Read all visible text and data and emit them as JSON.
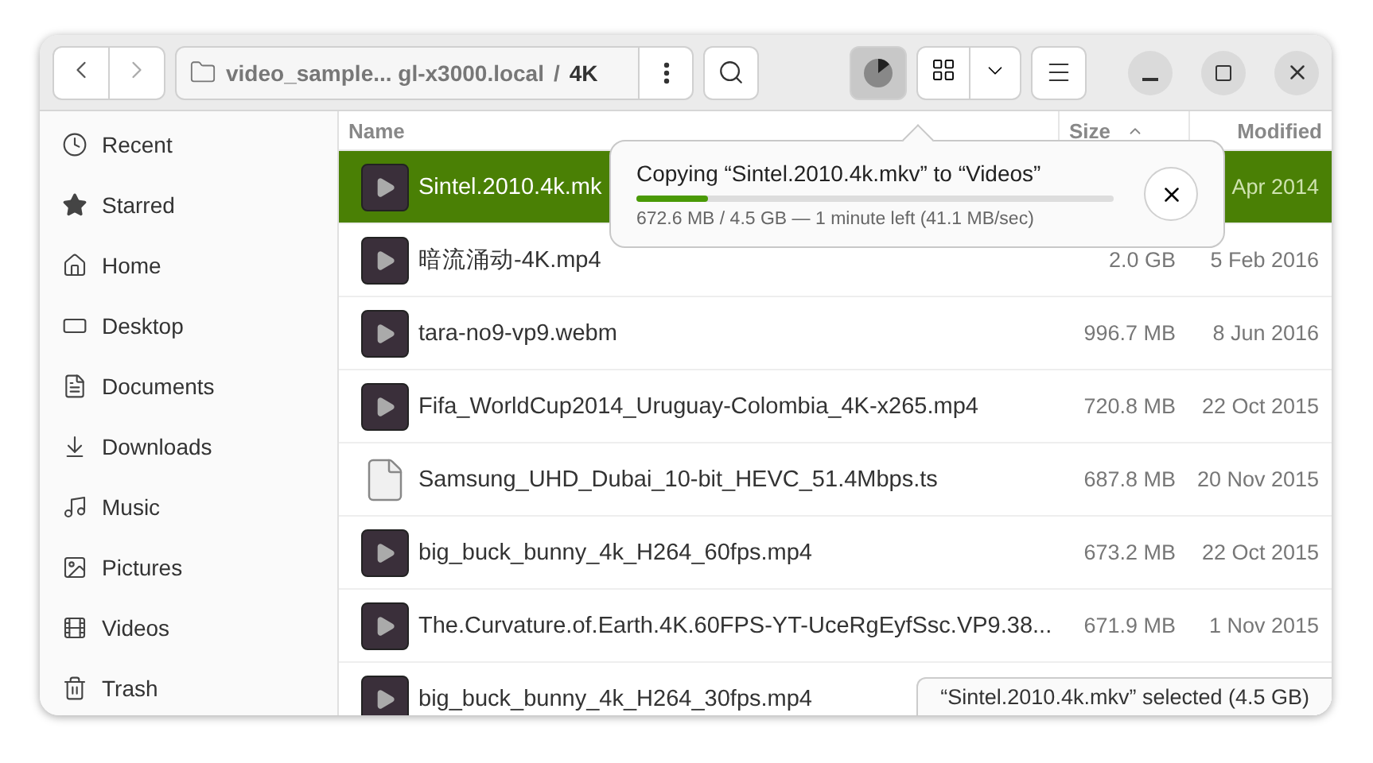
{
  "header": {
    "path_parent": "video_sample... gl-x3000.local",
    "path_separator": "/",
    "path_current": "4K"
  },
  "sidebar": {
    "items": [
      {
        "label": "Recent",
        "selected": false
      },
      {
        "label": "Starred",
        "selected": false
      },
      {
        "label": "Home",
        "selected": false
      },
      {
        "label": "Desktop",
        "selected": false
      },
      {
        "label": "Documents",
        "selected": false
      },
      {
        "label": "Downloads",
        "selected": false
      },
      {
        "label": "Music",
        "selected": false
      },
      {
        "label": "Pictures",
        "selected": false
      },
      {
        "label": "Videos",
        "selected": false
      },
      {
        "label": "Trash",
        "selected": false
      }
    ]
  },
  "table": {
    "columns": [
      "Name",
      "Size",
      "Modified"
    ],
    "rows": [
      {
        "name": "Sintel.2010.4k.mk",
        "size": "",
        "modified": "Apr 2014",
        "kind": "video",
        "selected": true
      },
      {
        "name": "暗流涌动-4K.mp4",
        "size": "2.0 GB",
        "modified": "5 Feb 2016",
        "kind": "video",
        "selected": false
      },
      {
        "name": "tara-no9-vp9.webm",
        "size": "996.7 MB",
        "modified": "8 Jun 2016",
        "kind": "video",
        "selected": false
      },
      {
        "name": "Fifa_WorldCup2014_Uruguay-Colombia_4K-x265.mp4",
        "size": "720.8 MB",
        "modified": "22 Oct 2015",
        "kind": "video",
        "selected": false
      },
      {
        "name": "Samsung_UHD_Dubai_10-bit_HEVC_51.4Mbps.ts",
        "size": "687.8 MB",
        "modified": "20 Nov 2015",
        "kind": "document",
        "selected": false
      },
      {
        "name": "big_buck_bunny_4k_H264_60fps.mp4",
        "size": "673.2 MB",
        "modified": "22 Oct 2015",
        "kind": "video",
        "selected": false
      },
      {
        "name": "The.Curvature.of.Earth.4K.60FPS-YT-UceRgEyfSsc.VP9.38...",
        "size": "671.9 MB",
        "modified": "1 Nov 2015",
        "kind": "video",
        "selected": false
      },
      {
        "name": "big_buck_bunny_4k_H264_30fps.mp4",
        "size": "",
        "modified": "",
        "kind": "video",
        "selected": false
      }
    ]
  },
  "operation": {
    "title": "Copying “Sintel.2010.4k.mkv” to “Videos”",
    "level": 0.15,
    "detail": "672.6 MB / 4.5 GB — 1 minute left (41.1 MB/sec)"
  },
  "status_bar": "“Sintel.2010.4k.mkv” selected  (4.5 GB)"
}
